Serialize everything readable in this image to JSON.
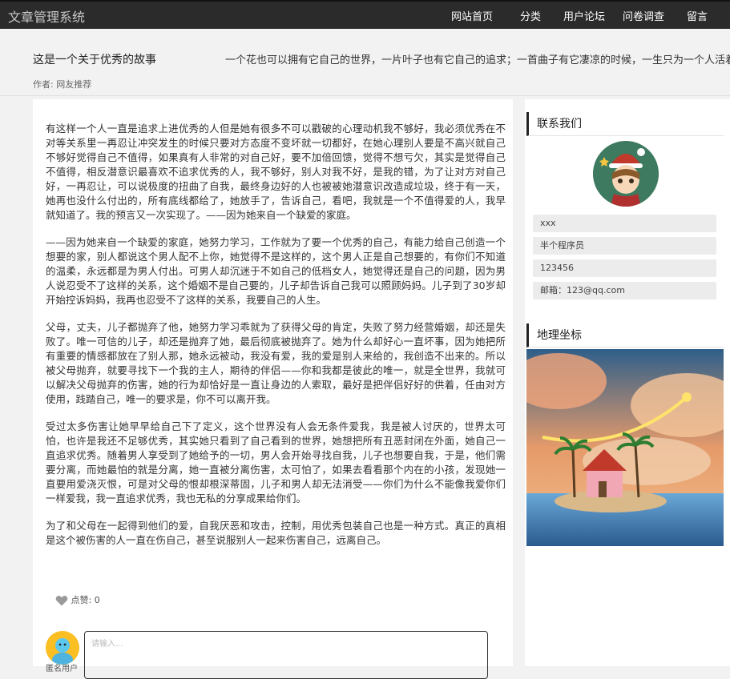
{
  "nav": {
    "brand": "文章管理系统",
    "links": [
      "网站首页",
      "分类",
      "用户论坛",
      "问卷调查",
      "留言"
    ]
  },
  "article": {
    "title": "这是一个关于优秀的故事",
    "tagline": "一个花也可以拥有它自己的世界，一片叶子也有它自己的追求；一首曲子有它凄凉的时候，一生只为一个人活着。",
    "author": "作者: 网友推荐",
    "paragraphs": [
      "有这样一个人一直是追求上进优秀的人但是她有很多不可以戳破的心理动机我不够好，我必须优秀在不对等关系里一再忍让冲突发生的时候只要对方态度不变坏就一切都好，在她心理别人要是不高兴就自己不够好觉得自己不值得，如果真有人非常的对自己好，要不加倍回馈，觉得不想亏欠，其实是觉得自己不值得，相反潜意识最喜欢不追求优秀的人，我不够好，别人对我不好，是我的错，为了让对方对自己好，一再忍让，可以说极度的扭曲了自我，最终身边好的人也被被她潜意识改造成垃圾，终于有一天，她再也没什么付出的，所有底线都给了，她放手了，告诉自己，看吧，我就是一个不值得爱的人，我早就知道了。我的预言又一次实现了。——因为她来自一个缺爱的家庭。",
      "——因为她来自一个缺爱的家庭，她努力学习，工作就为了要一个优秀的自己，有能力给自己创造一个想要的家，别人都说这个男人配不上你，她觉得不是这样的，这个男人正是自己想要的，有你们不知道的温柔，永远都是为男人付出。可男人却沉迷于不如自己的低档女人，她觉得还是自己的问题，因为男人说忍受不了这样的关系，这个婚姻不是自己要的，儿子却告诉自己我可以照顾妈妈。儿子到了30岁却开始控诉妈妈，我再也忍受不了这样的关系，我要自己的人生。",
      "父母，丈夫，儿子都抛弃了他，她努力学习乖就为了获得父母的肯定，失败了努力经营婚姻，却还是失败了。唯一可信的儿子，却还是抛弃了她，最后彻底被抛弃了。她为什么却好心一直坏事，因为她把所有重要的情感都放在了别人那，她永远被动，我没有爱，我的爱是别人来给的，我创造不出来的。所以被父母抛弃，就要寻找下一个我的主人，期待的伴侣——你和我都是彼此的唯一，就是全世界，我就可以解决父母抛弃的伤害，她的行为却恰好是一直让身边的人索取，最好是把伴侣好好的供着，任由对方使用，践踏自己，唯一的要求是，你不可以离开我。",
      "受过太多伤害让她早早给自己下了定义，这个世界没有人会无条件爱我，我是被人讨厌的，世界太可怕，也许是我还不足够优秀，其实她只看到了自己看到的世界，她想把所有丑恶封闭在外面，她自己一直追求优秀。随着男人享受到了她给予的一切，男人会开始寻找自我，儿子也想要自我，于是，他们需要分离，而她最怕的就是分离，她一直被分离伤害，太可怕了，如果去看看那个内在的小孩，发现她一直要用爱浇灭恨，可是对父母的恨却根深蒂固，儿子和男人却无法消受——你们为什么不能像我爱你们一样爱我，我一直追求优秀，我也无私的分享成果给你们。",
      "为了和父母在一起得到他们的爱，自我厌恶和攻击，控制，用优秀包装自己也是一种方式。真正的真相是这个被伤害的人一直在伤自己，甚至说服别人一起来伤害自己，远离自己。"
    ],
    "like_label": "点赞: 0",
    "comment_placeholder": "请输入...",
    "commenter_label": "匿名用户"
  },
  "sidebar": {
    "contact_title": "联系我们",
    "info": [
      "xxx",
      "半个程序员",
      "123456",
      "邮箱：123@qq.com"
    ],
    "map_title": "地理坐标"
  },
  "colors": {
    "navbar_bg": "#2b2b2b",
    "brand_text": "#c9c9c9",
    "accent_bar": "#222222",
    "info_bg": "#ececec"
  },
  "icons": [
    "heart-icon",
    "user-avatar-icon",
    "profile-avatar-image",
    "map-landscape-image"
  ]
}
